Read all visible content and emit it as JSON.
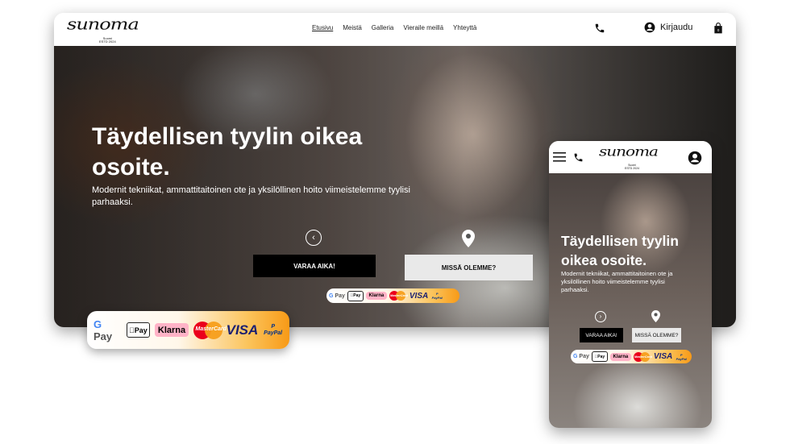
{
  "brand": {
    "logo_text": "sunoma",
    "logo_sub": "Suomi\nESTD 2024"
  },
  "nav": {
    "items": [
      "Etusivu",
      "Meistä",
      "Galleria",
      "Vieraile meillä",
      "Yhteyttä"
    ],
    "login": "Kirjaudu"
  },
  "hero": {
    "title": "Täydellisen tyylin oikea osoite.",
    "description": "Modernit tekniikat, ammattitaitoinen ote ja yksilöllinen hoito  viimeistelemme tyylisi parhaaksi.",
    "book_button": "VARAA AIKA!",
    "location_button": "MISSÄ OLEMME?"
  },
  "payments": {
    "gpay": "Pay",
    "gpay_g": "G",
    "applepay": "Pay",
    "applepay_logo": "",
    "klarna": "Klarna",
    "mastercard": "MasterCard",
    "visa": "VISA",
    "paypal": "PayPal"
  },
  "colors": {
    "accent_orange": "#f89a17",
    "button_dark": "#000000",
    "button_light": "#e9e9e9"
  }
}
